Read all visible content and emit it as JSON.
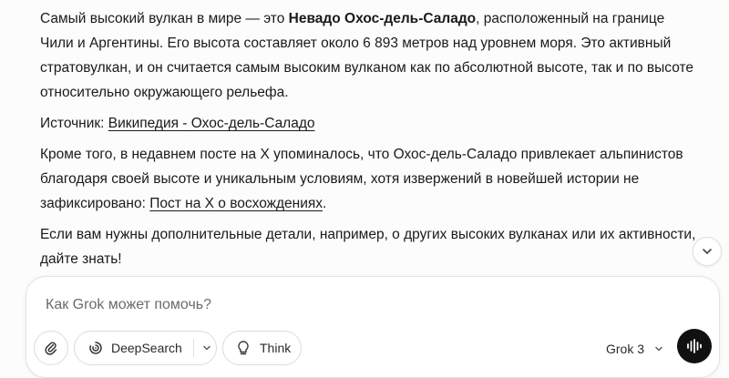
{
  "message": {
    "p1": {
      "before": "Самый высокий вулкан в мире — это ",
      "bold": "Невадо Охос-дель-Саладо",
      "after": ", расположенный на границе Чили и Аргентины. Его высота составляет около 6 893 метров над уровнем моря. Это активный стратовулкан, и он считается самым высоким вулканом как по абсолютной высоте, так и по высоте относительно окружающего рельефа."
    },
    "p2": {
      "before": "Источник: ",
      "link": "Википедия - Охос-дель-Саладо"
    },
    "p3": {
      "before": "Кроме того, в недавнем посте на X упоминалось, что Охос-дель-Саладо привлекает альпинистов благодаря своей высоте и уникальным условиям, хотя извержений в новейшей истории не зафиксировано: ",
      "link": "Пост на X о восхождениях",
      "after": "."
    },
    "p4": {
      "text": "Если вам нужны дополнительные детали, например, о других высоких вулканах или их активности, дайте знать!"
    }
  },
  "composer": {
    "placeholder": "Как Grok может помочь?",
    "value": "",
    "deepsearch_label": "DeepSearch",
    "think_label": "Think",
    "model_label": "Grok 3"
  },
  "icons": {
    "attach": "paperclip-icon",
    "deepsearch": "deepsearch-swirl-icon",
    "think": "lightbulb-icon",
    "voice": "voice-waveform-icon",
    "scroll": "chevron-down-icon"
  }
}
